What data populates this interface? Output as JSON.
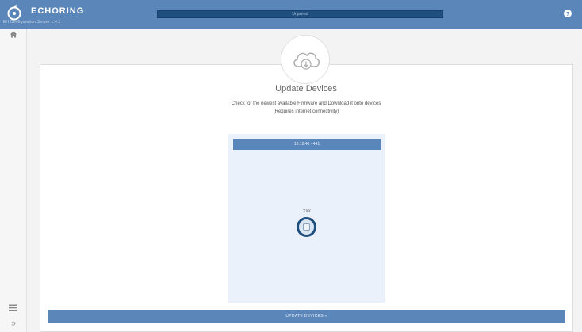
{
  "header": {
    "brand": "ECHORING",
    "subtitle": "EH Configuration Server 1.4.1",
    "status": "Unpaired",
    "colors": {
      "header_bg": "#5b86b9",
      "status_bar": "#1f4f7e"
    }
  },
  "icons": {
    "logo": "echoring-logo-icon",
    "help": "help-icon",
    "home": "home-icon",
    "menu": "menu-icon",
    "expand": "expand-icon",
    "cloud": "cloud-download-icon"
  },
  "sidebar": {
    "expand_glyph": "»"
  },
  "main": {
    "title": "Update Devices",
    "description_line1": "Check for the newest available Firmware and Download it onto devices",
    "description_line2": "(Requires internet connectivity)",
    "panel": {
      "header": "18:10:40 - 441",
      "device_label": "XXX"
    },
    "update_button": "UPDATE DEVICES »"
  }
}
